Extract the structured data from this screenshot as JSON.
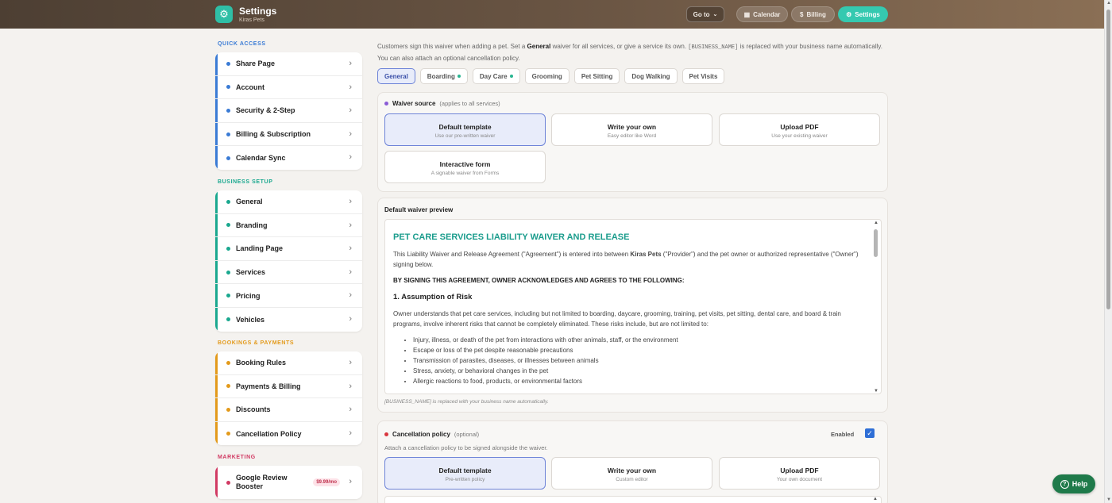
{
  "header": {
    "title": "Settings",
    "subtitle": "Kiras Pets",
    "goto_label": "Go to",
    "calendar_label": "Calendar",
    "billing_label": "Billing",
    "settings_label": "Settings"
  },
  "sidebar": {
    "quick_access": {
      "title": "QUICK ACCESS",
      "color": "#3a7bd5",
      "items": [
        "Share Page",
        "Account",
        "Security & 2-Step",
        "Billing & Subscription",
        "Calendar Sync"
      ]
    },
    "business_setup": {
      "title": "BUSINESS SETUP",
      "color": "#1aa88f",
      "items": [
        "General",
        "Branding",
        "Landing Page",
        "Services",
        "Pricing",
        "Vehicles"
      ]
    },
    "bookings_payments": {
      "title": "BOOKINGS & PAYMENTS",
      "color": "#e39a1b",
      "items": [
        "Booking Rules",
        "Payments & Billing",
        "Discounts",
        "Cancellation Policy"
      ]
    },
    "marketing": {
      "title": "MARKETING",
      "color": "#d13a63",
      "items": [
        {
          "label": "Google Review Booster",
          "badge": "$9.99/mo"
        }
      ]
    }
  },
  "main": {
    "intro": {
      "part1": "Customers sign this waiver when adding a pet. Set a ",
      "bold": "General",
      "part2": " waiver for all services, or give a service its own. ",
      "code": "[BUSINESS_NAME]",
      "part3": " is replaced with your business name automatically. You can also attach an optional cancellation policy."
    },
    "tabs": [
      {
        "label": "General",
        "active": true,
        "dot": false
      },
      {
        "label": "Boarding",
        "active": false,
        "dot": true
      },
      {
        "label": "Day Care",
        "active": false,
        "dot": true
      },
      {
        "label": "Grooming",
        "active": false,
        "dot": false
      },
      {
        "label": "Pet Sitting",
        "active": false,
        "dot": false
      },
      {
        "label": "Dog Walking",
        "active": false,
        "dot": false
      },
      {
        "label": "Pet Visits",
        "active": false,
        "dot": false
      }
    ],
    "waiver_source": {
      "label": "Waiver source",
      "note": "(applies to all services)",
      "options": [
        {
          "title": "Default template",
          "sub": "Use our pre-written waiver",
          "selected": true
        },
        {
          "title": "Write your own",
          "sub": "Easy editor like Word",
          "selected": false
        },
        {
          "title": "Upload PDF",
          "sub": "Use your existing waiver",
          "selected": false
        },
        {
          "title": "Interactive form",
          "sub": "A signable waiver from Forms",
          "selected": false
        }
      ]
    },
    "preview": {
      "label": "Default waiver preview",
      "heading": "PET CARE SERVICES LIABILITY WAIVER AND RELEASE",
      "p1_a": "This Liability Waiver and Release Agreement (\"Agreement\") is entered into between ",
      "p1_b": "Kiras Pets",
      "p1_c": " (\"Provider\") and the pet owner or authorized representative (\"Owner\") signing below.",
      "caps": "BY SIGNING THIS AGREEMENT, OWNER ACKNOWLEDGES AND AGREES TO THE FOLLOWING:",
      "section1": "1. Assumption of Risk",
      "p2": "Owner understands that pet care services, including but not limited to boarding, daycare, grooming, training, pet visits, pet sitting, dental care, and board & train programs, involve inherent risks that cannot be completely eliminated. These risks include, but are not limited to:",
      "bullets": [
        "Injury, illness, or death of the pet from interactions with other animals, staff, or the environment",
        "Escape or loss of the pet despite reasonable precautions",
        "Transmission of parasites, diseases, or illnesses between animals",
        "Stress, anxiety, or behavioral changes in the pet",
        "Allergic reactions to food, products, or environmental factors"
      ],
      "footnote": "[BUSINESS_NAME] is replaced with your business name automatically."
    },
    "cancellation": {
      "label": "Cancellation policy",
      "note": "(optional)",
      "enabled_label": "Enabled",
      "enabled": true,
      "attach_text": "Attach a cancellation policy to be signed alongside the waiver.",
      "options": [
        {
          "title": "Default template",
          "sub": "Pre-written policy",
          "selected": true
        },
        {
          "title": "Write your own",
          "sub": "Custom editor",
          "selected": false
        },
        {
          "title": "Upload PDF",
          "sub": "Your own document",
          "selected": false
        }
      ]
    },
    "help_label": "Help"
  },
  "colors": {
    "accent": "#35c9b0",
    "selected_border": "#6d83d8",
    "heading_teal": "#1a9c8c",
    "waiver_dot": "#8a5cd6",
    "cancel_dot": "#d9363e"
  }
}
